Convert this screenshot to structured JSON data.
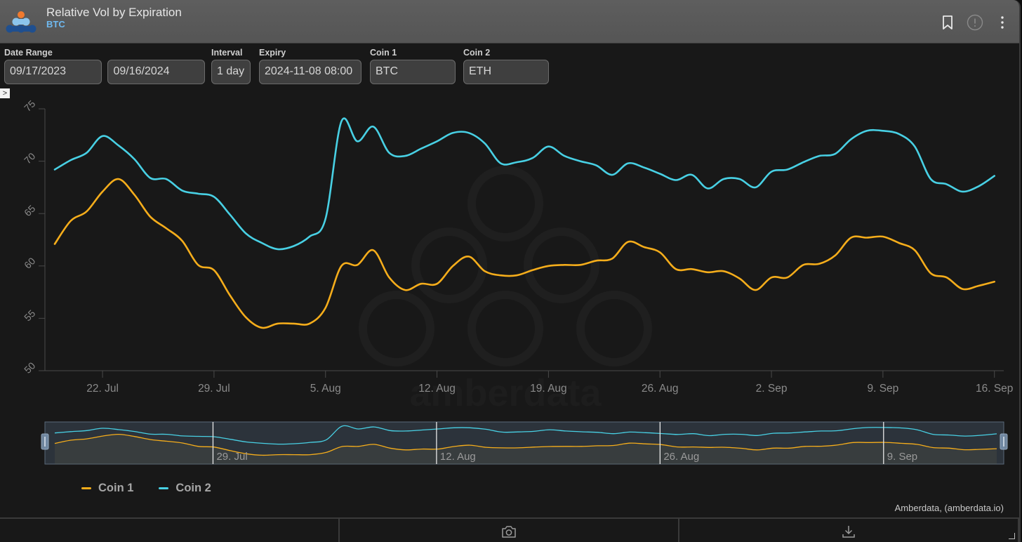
{
  "header": {
    "title": "Relative Vol by Expiration",
    "subtitle": "BTC",
    "icons": [
      "bookmark-icon",
      "alert-info-icon",
      "more-vertical-icon"
    ]
  },
  "controls": {
    "date_range_label": "Date Range",
    "date_start": "09/17/2023",
    "date_end": "09/16/2024",
    "interval_label": "Interval",
    "interval_value": "1 day",
    "expiry_label": "Expiry",
    "expiry_value": "2024-11-08 08:00",
    "coin1_label": "Coin 1",
    "coin1_value": "BTC",
    "coin2_label": "Coin 2",
    "coin2_value": "ETH",
    "expand_glyph": ">"
  },
  "colors": {
    "coin1": "#f5ad1b",
    "coin2": "#48d0e4",
    "background": "#181818",
    "axis": "#4a4a4a",
    "tick_label": "#8a8a8a"
  },
  "chart_data": {
    "type": "line",
    "title": "Relative Vol by Expiration",
    "xlabel": "",
    "ylabel": "",
    "x_start": "2024-07-19",
    "x_interval": "1 day",
    "x_ticks": [
      "22. Jul",
      "29. Jul",
      "5. Aug",
      "12. Aug",
      "19. Aug",
      "26. Aug",
      "2. Sep",
      "9. Sep",
      "16. Sep"
    ],
    "x_tick_day_offsets": [
      3,
      10,
      17,
      24,
      31,
      38,
      45,
      52,
      59
    ],
    "y_ticks": [
      50,
      55,
      60,
      65,
      70,
      75
    ],
    "ylim": [
      50,
      75
    ],
    "grid": false,
    "legend_position": "bottom-left",
    "series": [
      {
        "name": "Coin 1",
        "color": "#f5ad1b",
        "values": [
          62.1,
          64.3,
          65.2,
          67.1,
          68.3,
          66.8,
          64.7,
          63.6,
          62.4,
          60.1,
          59.6,
          57.2,
          55.1,
          54.1,
          54.5,
          54.5,
          54.5,
          56.0,
          60.0,
          60.1,
          61.5,
          58.9,
          57.7,
          58.3,
          58.3,
          60.0,
          60.9,
          59.5,
          59.1,
          59.1,
          59.6,
          60.0,
          60.1,
          60.1,
          60.5,
          60.7,
          62.3,
          61.8,
          61.3,
          59.7,
          59.7,
          59.4,
          59.5,
          58.8,
          57.7,
          58.9,
          58.9,
          60.1,
          60.2,
          61.0,
          62.7,
          62.7,
          62.8,
          62.2,
          61.5,
          59.3,
          58.9,
          57.8,
          58.1,
          58.5
        ]
      },
      {
        "name": "Coin 2",
        "color": "#48d0e4",
        "values": [
          69.2,
          70.1,
          70.8,
          72.4,
          71.5,
          70.2,
          68.4,
          68.3,
          67.2,
          66.9,
          66.6,
          64.9,
          63.1,
          62.2,
          61.6,
          61.9,
          62.8,
          64.5,
          73.8,
          71.9,
          73.3,
          70.8,
          70.5,
          71.2,
          71.9,
          72.7,
          72.7,
          71.7,
          69.8,
          69.9,
          70.3,
          71.4,
          70.5,
          70.0,
          69.6,
          68.7,
          69.8,
          69.4,
          68.8,
          68.2,
          68.7,
          67.4,
          68.3,
          68.3,
          67.5,
          69.0,
          69.2,
          69.9,
          70.5,
          70.7,
          72.1,
          72.9,
          72.9,
          72.6,
          71.4,
          68.3,
          67.8,
          67.1,
          67.6,
          68.6
        ]
      }
    ],
    "navigator": {
      "labels": [
        "29. Jul",
        "12. Aug",
        "26. Aug",
        "9. Sep"
      ],
      "label_day_offsets": [
        10,
        24,
        38,
        52
      ],
      "selection": "full range"
    },
    "watermark": "amberdata"
  },
  "legend": {
    "items": [
      {
        "label": "Coin 1",
        "color": "#f5ad1b"
      },
      {
        "label": "Coin 2",
        "color": "#48d0e4"
      }
    ]
  },
  "credits": "Amberdata, (amberdata.io)",
  "footer": {
    "icons": [
      "blank",
      "camera-icon",
      "download-icon"
    ]
  }
}
